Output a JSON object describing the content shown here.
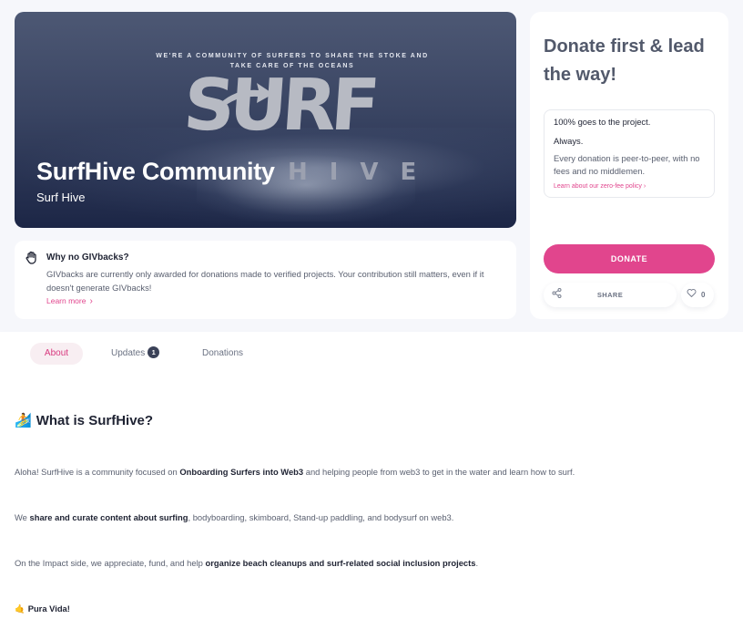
{
  "hero": {
    "tagline": "WE'RE A COMMUNITY OF SURFERS TO SHARE THE STOKE AND TAKE CARE OF THE OCEANS",
    "logo_top": "SURF",
    "logo_bottom": "HIVE",
    "title": "SurfHive Community",
    "subtitle": "Surf Hive"
  },
  "givbacks": {
    "icon": "hand-icon",
    "title": "Why no GIVbacks?",
    "text": "GIVbacks are currently only awarded for donations made to verified projects. Your contribution still matters, even if it doesn't generate GIVbacks!",
    "link": "Learn more"
  },
  "donate": {
    "heading": "Donate first & lead the way!",
    "info_line1": "100% goes to the project.",
    "info_line2": "Always.",
    "info_line3": "Every donation is peer-to-peer, with no fees and no middlemen.",
    "info_link": "Learn about our zero-fee policy",
    "donate_label": "DONATE",
    "share_label": "SHARE",
    "like_count": "0"
  },
  "tabs": {
    "about": "About",
    "updates": "Updates",
    "updates_badge": "1",
    "donations": "Donations"
  },
  "about": {
    "title": "What is SurfHive?",
    "p1_a": "Aloha! SurfHive is a community focused on ",
    "p1_b": "Onboarding Surfers into Web3",
    "p1_c": " and helping people from web3 to get in the water and learn how to surf.",
    "p2_a": "We ",
    "p2_b": "share and curate content about surfing",
    "p2_c": ", bodyboarding, skimboard, Stand-up paddling, and bodysurf on web3.",
    "p3_a": "On the Impact side, we appreciate, fund, and help ",
    "p3_b": "organize beach cleanups and surf-related social inclusion projects",
    "p3_c": ".",
    "p4": "Pura Vida!"
  },
  "colors": {
    "accent": "#e1458d",
    "background": "#f6f7fb",
    "heading": "#52596b"
  }
}
